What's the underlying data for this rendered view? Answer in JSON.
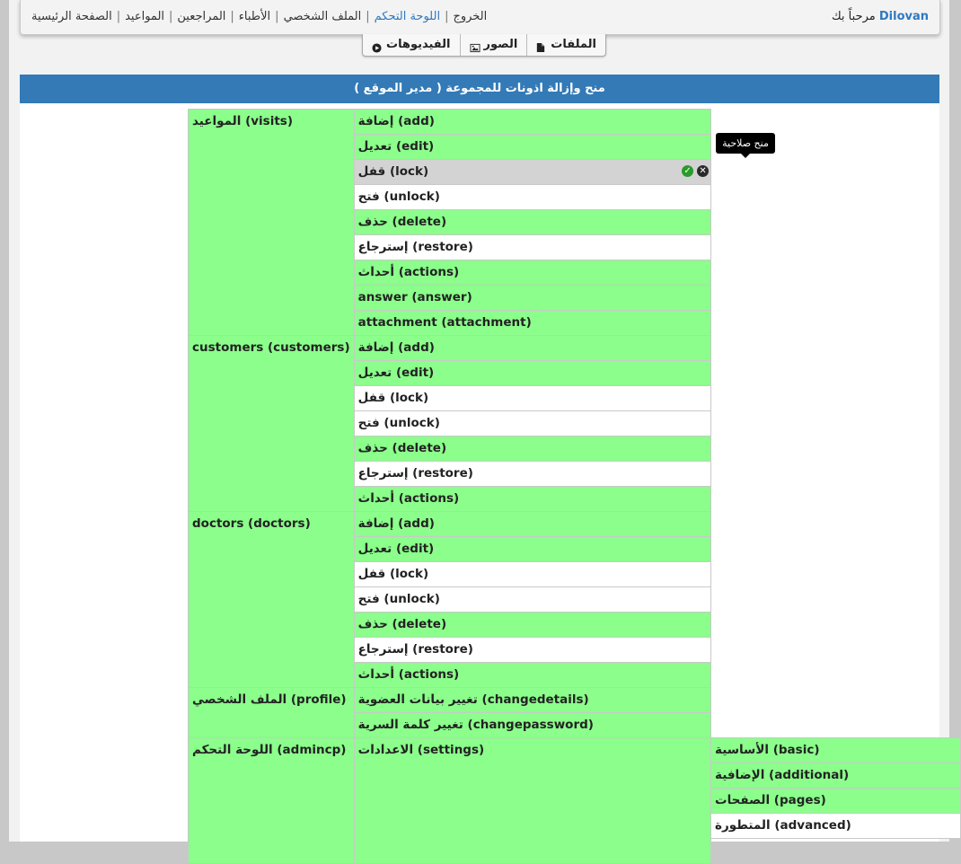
{
  "nav": {
    "welcome": "مرحباً بك",
    "username": "Dilovan",
    "links": [
      "الخروج",
      "اللوحة التحكم",
      "الملف الشخصي",
      "الأطباء",
      "المراجعين",
      "المواعيد",
      "الصفحة الرئيسية"
    ],
    "active_link": "اللوحة التحكم"
  },
  "tabs": [
    {
      "label": "الفيديوهات",
      "icon": "play-circle-icon"
    },
    {
      "label": "الصور",
      "icon": "image-icon"
    },
    {
      "label": "الملفات",
      "icon": "file-icon"
    }
  ],
  "header": {
    "title": "منح وإزالة اذونات للمجموعة ( مدير الموقع )"
  },
  "tooltip": "منح صلاحية",
  "colors": {
    "granted": "#8bfe8b",
    "denied": "#ffffff",
    "hover": "#d3d3d3",
    "header": "#337ab7",
    "active_link": "#2e79c0"
  },
  "groups": [
    {
      "name": "المواعيد (visits)",
      "perms": [
        {
          "label": "إضافة (add)",
          "granted": true
        },
        {
          "label": "تعديل (edit)",
          "granted": true
        },
        {
          "label": "قفل (lock)",
          "granted": false,
          "hover": true
        },
        {
          "label": "فتح (unlock)",
          "granted": false
        },
        {
          "label": "حذف (delete)",
          "granted": true
        },
        {
          "label": "إسترجاع (restore)",
          "granted": false
        },
        {
          "label": "أحداث (actions)",
          "granted": true
        },
        {
          "label": "answer (answer)",
          "granted": true
        },
        {
          "label": "attachment (attachment)",
          "granted": true
        }
      ]
    },
    {
      "name": "customers (customers)",
      "perms": [
        {
          "label": "إضافة (add)",
          "granted": true
        },
        {
          "label": "تعديل (edit)",
          "granted": true
        },
        {
          "label": "قفل (lock)",
          "granted": false
        },
        {
          "label": "فتح (unlock)",
          "granted": false
        },
        {
          "label": "حذف (delete)",
          "granted": true
        },
        {
          "label": "إسترجاع (restore)",
          "granted": false
        },
        {
          "label": "أحداث (actions)",
          "granted": true
        }
      ]
    },
    {
      "name": "doctors (doctors)",
      "perms": [
        {
          "label": "إضافة (add)",
          "granted": true
        },
        {
          "label": "تعديل (edit)",
          "granted": true
        },
        {
          "label": "قفل (lock)",
          "granted": false
        },
        {
          "label": "فتح (unlock)",
          "granted": false
        },
        {
          "label": "حذف (delete)",
          "granted": true
        },
        {
          "label": "إسترجاع (restore)",
          "granted": false
        },
        {
          "label": "أحداث (actions)",
          "granted": true
        }
      ]
    },
    {
      "name": "الملف الشخصي (profile)",
      "perms": [
        {
          "label": "تغيير بيانات العضوية (changedetails)",
          "granted": true
        },
        {
          "label": "تغيير كلمة السرية (changepassword)",
          "granted": true
        }
      ]
    },
    {
      "name": "اللوحة التحكم (admincp)",
      "sub": "الاعدادات (settings)",
      "perms": [
        {
          "label": "الأساسية (basic)",
          "granted": true
        },
        {
          "label": "الإضافية (additional)",
          "granted": true
        },
        {
          "label": "الصفحات (pages)",
          "granted": true
        },
        {
          "label": "المتطورة (advanced)",
          "granted": false
        },
        {
          "label": "",
          "granted": false
        }
      ]
    }
  ]
}
